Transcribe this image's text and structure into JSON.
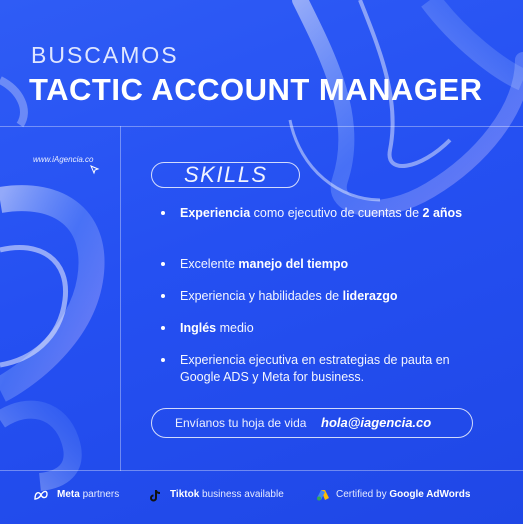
{
  "header": {
    "kicker": "BUSCAMOS",
    "title": "TACTIC ACCOUNT MANAGER"
  },
  "website": "www.iAgencia.co",
  "skills": {
    "heading": "SKILLS",
    "items": [
      {
        "b1": "Experiencia",
        "t1": " como ejecutivo de cuentas de ",
        "b2": "2 años",
        "t2": ""
      },
      {
        "b1": "",
        "t1": "Excelente ",
        "b2": "manejo del tiempo",
        "t2": ""
      },
      {
        "b1": "",
        "t1": "Experiencia y habilidades de ",
        "b2": "liderazgo",
        "t2": ""
      },
      {
        "b1": "Inglés",
        "t1": " medio",
        "b2": "",
        "t2": ""
      },
      {
        "b1": "",
        "t1": "Experiencia ejecutiva en estrategias de pauta en Google ADS y Meta for business.",
        "b2": "",
        "t2": ""
      }
    ]
  },
  "cta": {
    "text": "Envíanos tu hoja de vida",
    "email": "hola@iagencia.co"
  },
  "footer": {
    "meta_bold": "Meta",
    "meta_rest": " partners",
    "tiktok_bold": "Tiktok",
    "tiktok_rest": " business available",
    "google_pre": "Certified by ",
    "google_bold": "Google AdWords"
  },
  "colors": {
    "background": "#2550f2",
    "text": "#ffffff"
  },
  "icons": [
    "cursor-icon",
    "meta-icon",
    "tiktok-icon",
    "google-ads-icon"
  ]
}
